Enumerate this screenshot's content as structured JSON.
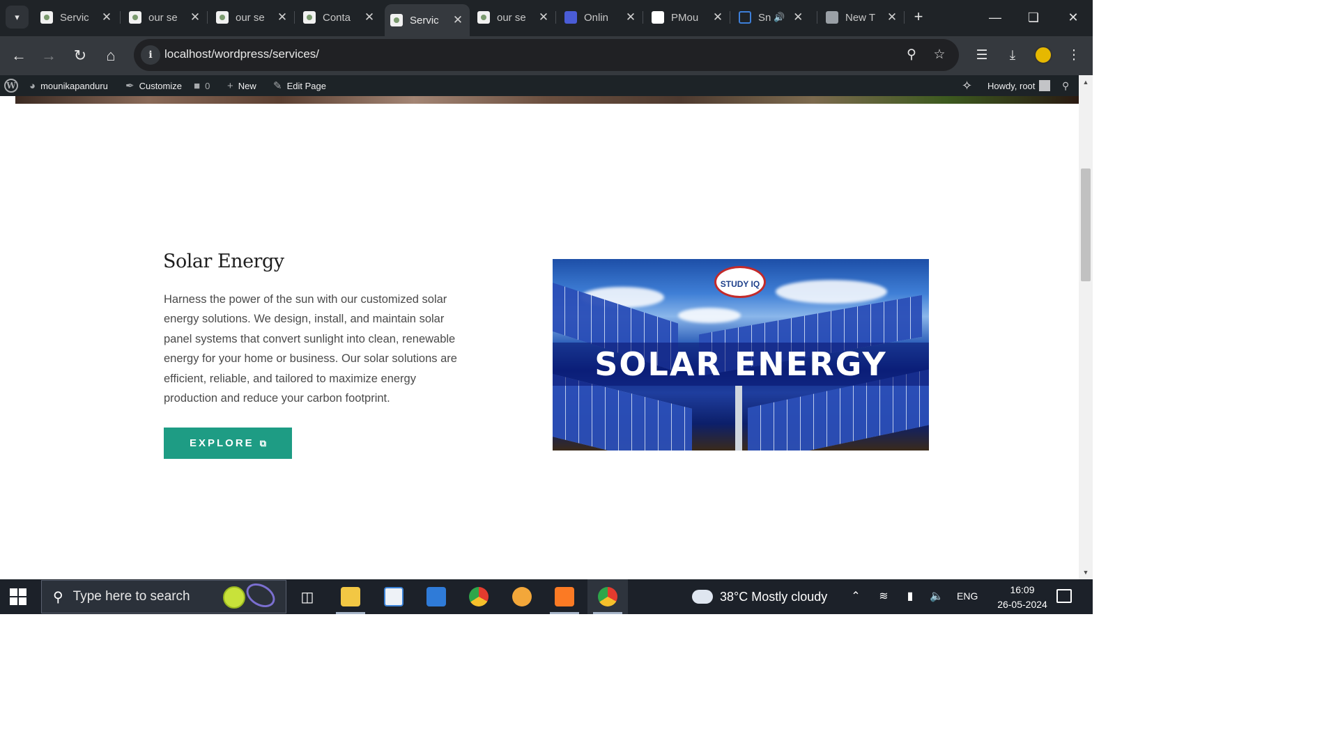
{
  "browser": {
    "tabs": [
      {
        "title": "Servic",
        "favicon": "wp-favicon-icon",
        "active": false
      },
      {
        "title": "our se",
        "favicon": "wp-favicon-icon",
        "active": false
      },
      {
        "title": "our se",
        "favicon": "wp-favicon-icon",
        "active": false
      },
      {
        "title": "Conta",
        "favicon": "wp-favicon-icon",
        "active": false
      },
      {
        "title": "Servic",
        "favicon": "wp-favicon-icon",
        "active": true
      },
      {
        "title": "our se",
        "favicon": "wp-favicon-icon",
        "active": false
      },
      {
        "title": "Onlin",
        "favicon": "online-favicon-icon",
        "active": false
      },
      {
        "title": "PMou",
        "favicon": "github-icon",
        "active": false
      },
      {
        "title": "Sn",
        "favicon": "sn-favicon-icon",
        "active": false,
        "audio": true
      },
      {
        "title": "New T",
        "favicon": "chrome-icon",
        "active": false
      }
    ],
    "url": "localhost/wordpress/services/"
  },
  "adminbar": {
    "site_name": "mounikapanduru",
    "customize": "Customize",
    "comments_count": "0",
    "new": "New",
    "edit_page": "Edit Page",
    "howdy": "Howdy, root"
  },
  "section": {
    "title": "Solar Energy",
    "description": "Harness the power of the sun with our customized solar energy solutions. We design, install, and maintain solar panel systems that convert sunlight into clean, renewable energy for your home or business. Our solar solutions are efficient, reliable, and tailored to maximize energy production and reduce your carbon footprint.",
    "button_label": "EXPLORE",
    "image_text": "SOLAR ENERGY",
    "image_logo_text": "STUDY IQ"
  },
  "taskbar": {
    "search_placeholder": "Type here to search",
    "weather": "38°C  Mostly cloudy",
    "language": "ENG",
    "time": "16:09",
    "date": "26-05-2024"
  },
  "colors": {
    "accent_button": "#1e9c84",
    "admin_bar": "#1d2327",
    "browser_frame": "#1f2327"
  }
}
